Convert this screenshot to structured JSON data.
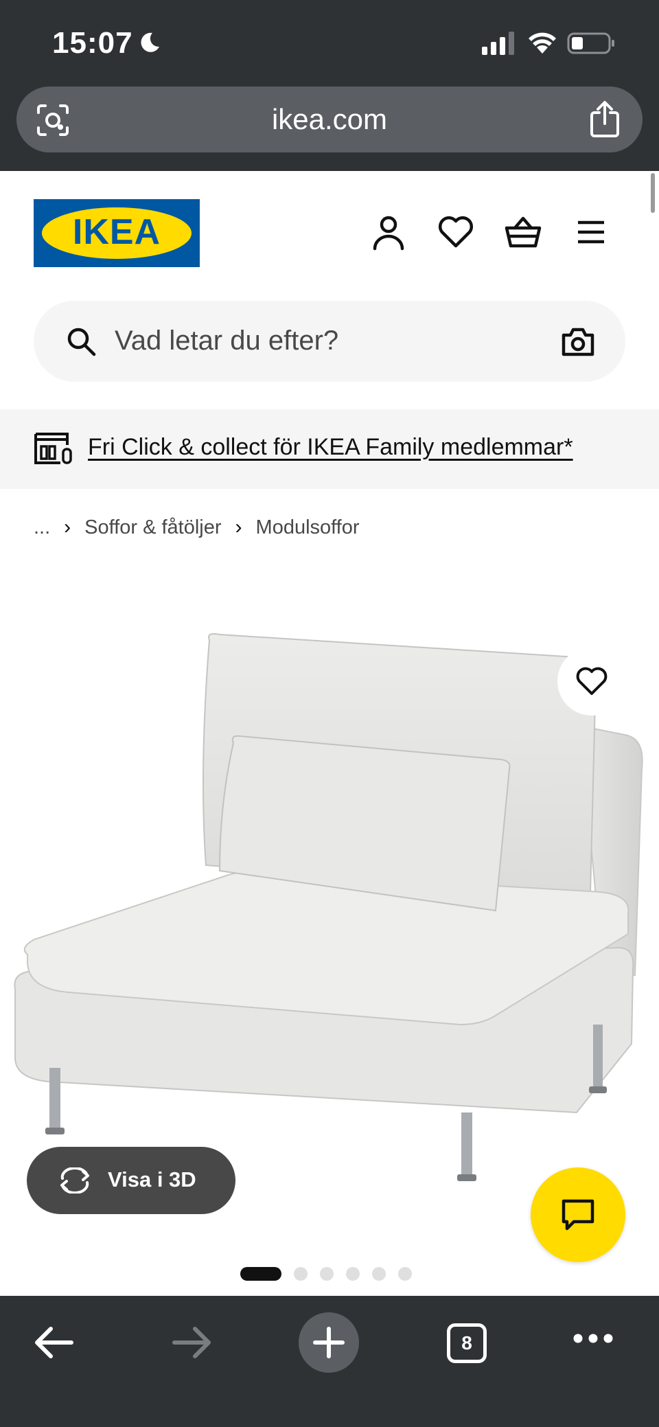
{
  "status_bar": {
    "time": "15:07",
    "icons": [
      "moon-icon",
      "signal-icon",
      "wifi-icon",
      "battery-icon"
    ]
  },
  "browser": {
    "url": "ikea.com",
    "left_icon": "page-scan-icon",
    "right_icon": "share-icon"
  },
  "header": {
    "logo_text": "IKEA",
    "icons": [
      "account-icon",
      "favorites-icon",
      "cart-icon",
      "menu-icon"
    ]
  },
  "search": {
    "placeholder": "Vad letar du efter?"
  },
  "promo": {
    "text": "Fri Click & collect för IKEA Family medlemmar*"
  },
  "breadcrumb": {
    "items": [
      "...",
      "Soffor & fåtöljer",
      "Modulsoffor"
    ]
  },
  "product": {
    "view_3d_label": "Visa i 3D",
    "image_count": 6,
    "active_image_index": 0
  },
  "toolbar": {
    "tab_count": "8",
    "icons": [
      "back-icon",
      "forward-icon",
      "new-tab-icon",
      "tabs-icon",
      "more-icon"
    ]
  },
  "colors": {
    "ikea_blue": "#0058a3",
    "ikea_yellow": "#ffdb00",
    "chrome_dark": "#2f3235"
  }
}
